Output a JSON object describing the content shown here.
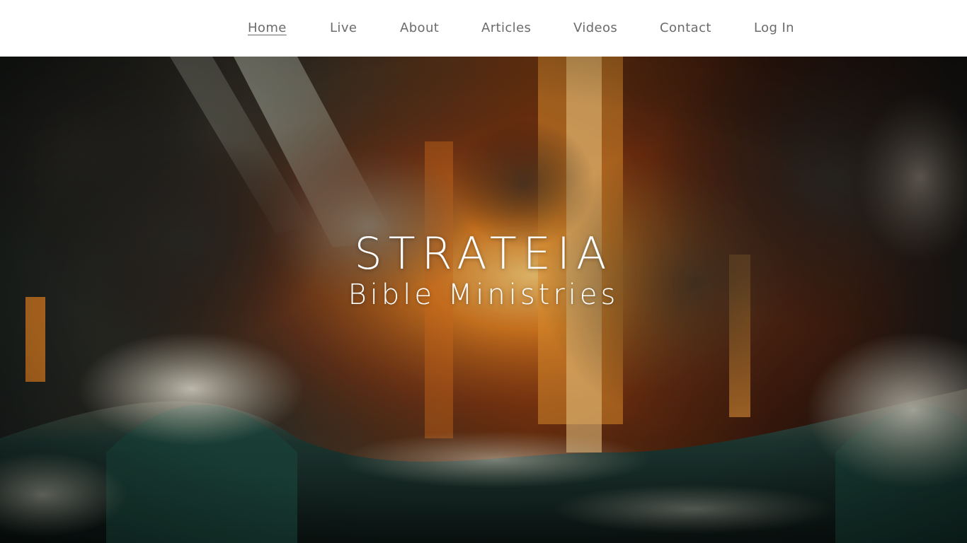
{
  "nav": {
    "items": [
      {
        "label": "Home",
        "active": true
      },
      {
        "label": "Live",
        "active": false
      },
      {
        "label": "About",
        "active": false
      },
      {
        "label": "Articles",
        "active": false
      },
      {
        "label": "Videos",
        "active": false
      },
      {
        "label": "Contact",
        "active": false
      },
      {
        "label": "Log In",
        "active": false
      }
    ]
  },
  "hero": {
    "title": "STRATEIA",
    "subtitle": "Bible Ministries",
    "background_image": "fiery-ocean-storm-image"
  },
  "colors": {
    "nav_bg": "#ffffff",
    "nav_text": "#6b6b6b",
    "hero_text": "#ffffff"
  }
}
